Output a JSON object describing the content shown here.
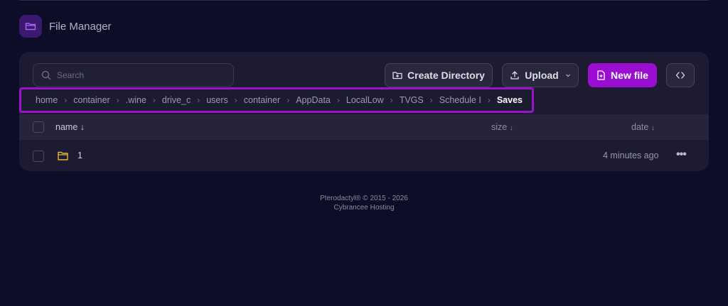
{
  "header": {
    "title": "File Manager",
    "icon": "folder-icon"
  },
  "toolbar": {
    "search_placeholder": "Search",
    "create_directory_label": "Create Directory",
    "upload_label": "Upload",
    "new_file_label": "New file",
    "accent_color": "#9a0ed1"
  },
  "breadcrumb": {
    "items": [
      "home",
      "container",
      ".wine",
      "drive_c",
      "users",
      "container",
      "AppData",
      "LocalLow",
      "TVGS",
      "Schedule I"
    ],
    "current": "Saves"
  },
  "table": {
    "columns": {
      "name": "name",
      "size": "size",
      "date": "date"
    },
    "sort_arrow": "↓",
    "rows": [
      {
        "name": "1",
        "type": "folder",
        "size": "",
        "date": "4 minutes ago"
      }
    ]
  },
  "footer": {
    "line1": "Pterodactyl® © 2015 - 2026",
    "line2": "Cybrancee Hosting"
  }
}
